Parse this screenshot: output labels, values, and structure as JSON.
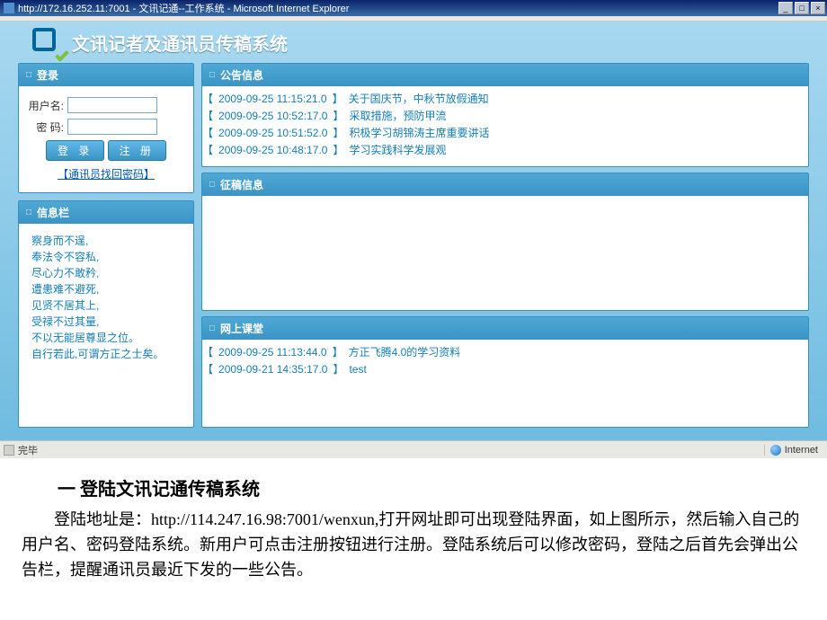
{
  "window": {
    "title": "http://172.16.252.11:7001 - 文讯记通--工作系统 - Microsoft Internet Explorer",
    "status_done": "完毕",
    "zone": "Internet"
  },
  "header": {
    "title": "文讯记者及通讯员传稿系统"
  },
  "login": {
    "panel_title": "登录",
    "user_label": "用户名:",
    "pass_label": "密  码:",
    "login_btn": "登 录",
    "register_btn": "注 册",
    "forgot_link": "【通讯员找回密码】"
  },
  "info": {
    "panel_title": "信息栏",
    "lines": [
      "察身而不逞,",
      "奉法令不容私,",
      "尽心力不敢矜,",
      "遭患难不避死,",
      "见贤不居其上,",
      "受禄不过其量,",
      "不以无能居尊显之位。",
      "自行若此,可谓方正之士矣。"
    ]
  },
  "notice": {
    "panel_title": "公告信息",
    "items": [
      {
        "ts": "2009-09-25 11:15:21.0",
        "txt": "关于国庆节，中秋节放假通知"
      },
      {
        "ts": "2009-09-25 10:52:17.0",
        "txt": "采取措施，预防甲流"
      },
      {
        "ts": "2009-09-25 10:51:52.0",
        "txt": "积极学习胡锦涛主席重要讲话"
      },
      {
        "ts": "2009-09-25 10:48:17.0",
        "txt": "学习实践科学发展观"
      }
    ]
  },
  "draft": {
    "panel_title": "征稿信息"
  },
  "classroom": {
    "panel_title": "网上课堂",
    "items": [
      {
        "ts": "2009-09-25 11:13:44.0",
        "txt": "方正飞腾4.0的学习资料"
      },
      {
        "ts": "2009-09-21 14:35:17.0",
        "txt": "test"
      }
    ]
  },
  "doc": {
    "heading": "一 登陆文讯记通传稿系统",
    "para": "登陆地址是：http://114.247.16.98:7001/wenxun,打开网址即可出现登陆界面，如上图所示，然后输入自己的用户名、密码登陆系统。新用户可点击注册按钮进行注册。登陆系统后可以修改密码，登陆之后首先会弹出公告栏，提醒通讯员最近下发的一些公告。"
  }
}
